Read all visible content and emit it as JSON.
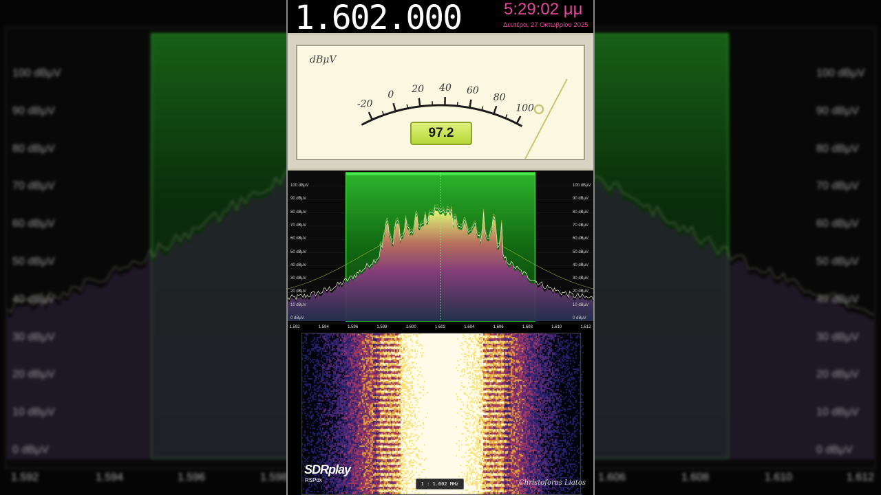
{
  "display": {
    "frequency": "1.602.000",
    "time": "5:29:02 μμ",
    "date": "Δευτέρα, 27 Οκτωβρίου 2025"
  },
  "meter": {
    "unit": "dBμV",
    "scale_labels": [
      "-20",
      "0",
      "20",
      "40",
      "60",
      "80",
      "100"
    ],
    "value": "97.2",
    "value_fraction": 0.97
  },
  "spectrum": {
    "db_labels": [
      "100 dBμV",
      "90 dBμV",
      "80 dBμV",
      "70 dBμV",
      "60 dBμV",
      "50 dBμV",
      "40 dBμV",
      "30 dBμV",
      "20 dBμV",
      "10 dBμV",
      "0 dBμV"
    ],
    "freq_labels": [
      "1.592",
      "1.594",
      "1.596",
      "1.598",
      "1.600",
      "1.602",
      "1.604",
      "1.606",
      "1.608",
      "1.610",
      "1.612"
    ],
    "center_mhz": 1.602,
    "passband_mhz": [
      1.5955,
      1.6085
    ],
    "span_mhz": [
      1.592,
      1.612
    ]
  },
  "background": {
    "db_labels": [
      "100 dBμV",
      "90 dBμV",
      "80 dBμV",
      "70 dBμV",
      "60 dBμV",
      "50 dBμV",
      "40 dBμV",
      "30 dBμV",
      "20 dBμV",
      "10 dBμV",
      "0 dBμV"
    ],
    "freq_labels": [
      "1.592",
      "1.594",
      "1.596",
      "1.598",
      "1.606",
      "1.608",
      "1.610",
      "1.612"
    ]
  },
  "footer": {
    "brand": "SDRplay",
    "model": "RSPdx",
    "zoom": "1 : 1.602 MHz",
    "credit": "Christoforos Liatos"
  },
  "colors": {
    "accent_time": "#e04a9a",
    "passband": "#2fa52f",
    "meter_value_bg": "#c9e65a"
  }
}
